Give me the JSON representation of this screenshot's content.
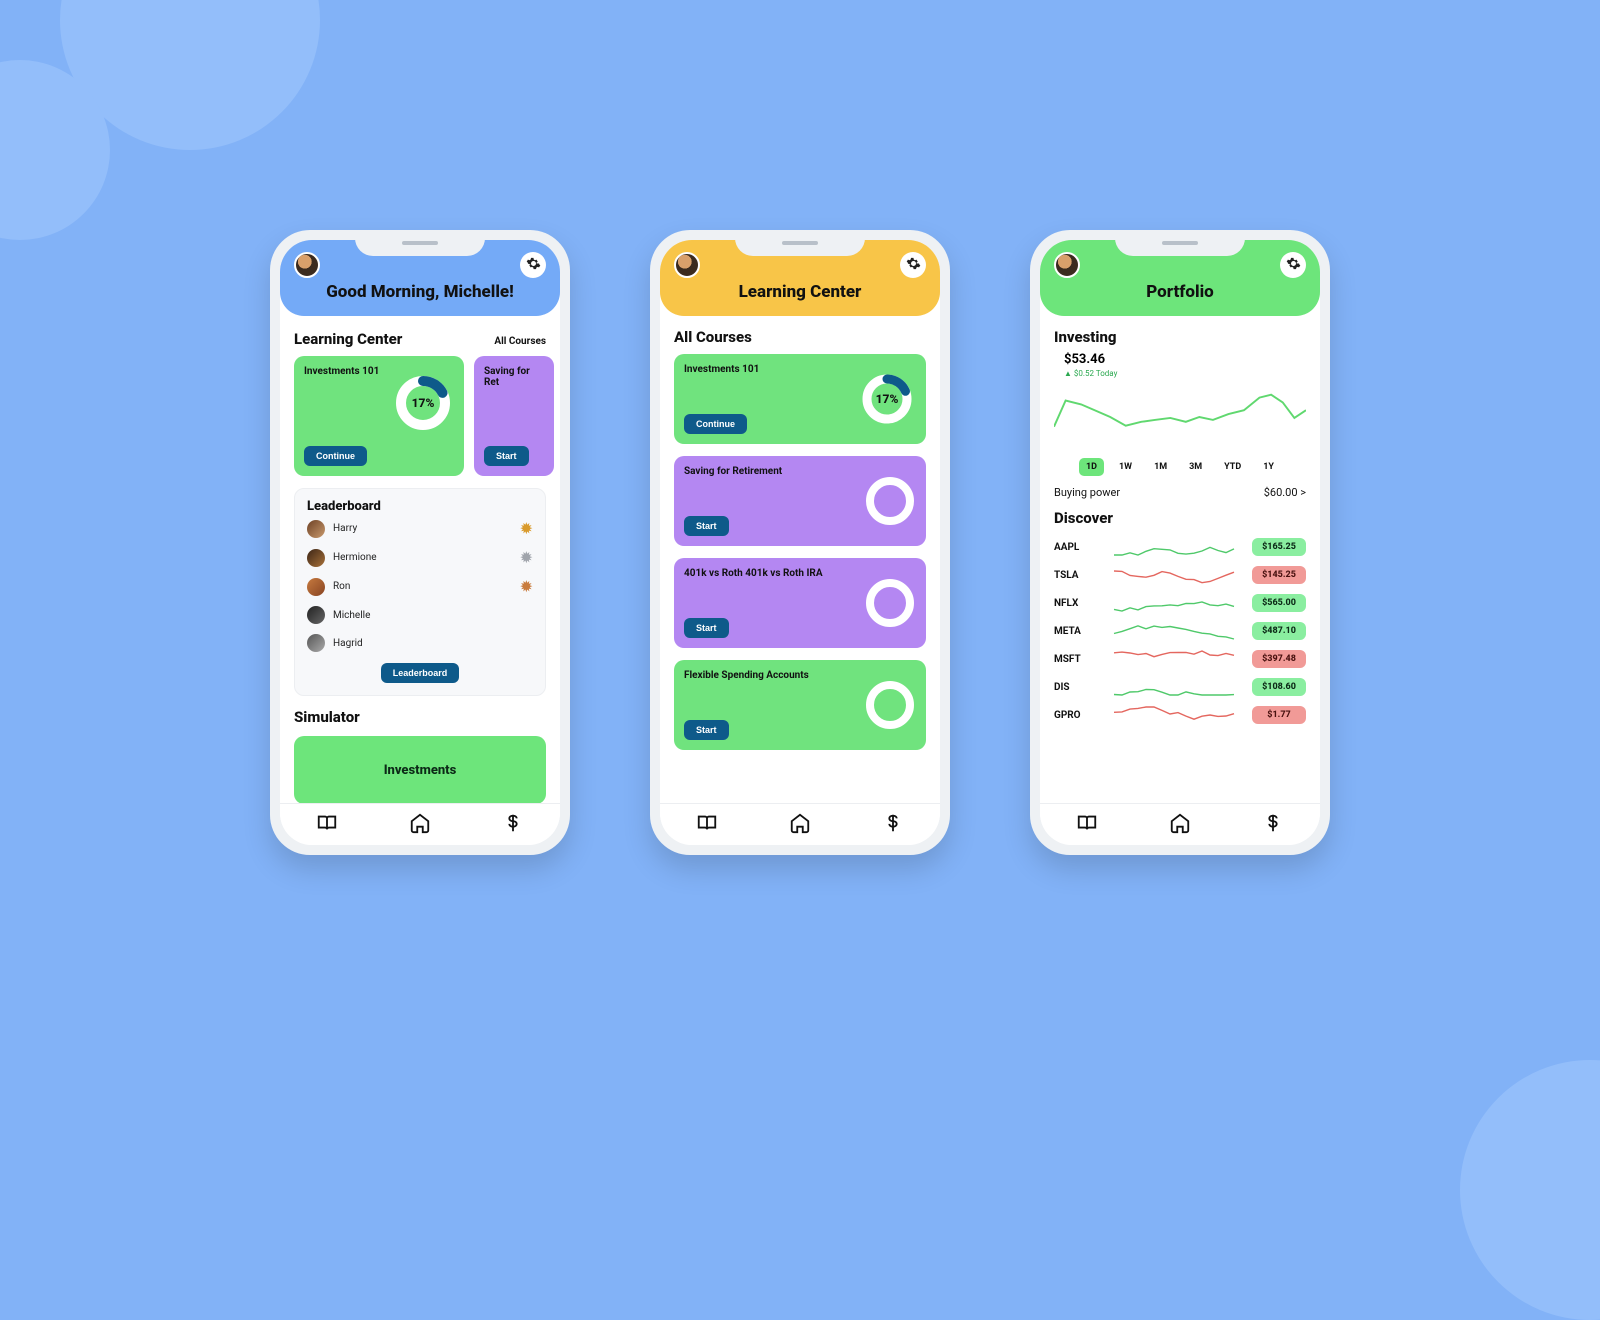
{
  "colors": {
    "blue": "#74aaf7",
    "yellow": "#f8c548",
    "green": "#6de57b",
    "purple": "#b487f2",
    "darkblue": "#0e5a8a"
  },
  "home": {
    "greeting": "Good Morning, Michelle!",
    "learning_title": "Learning Center",
    "all_courses_link": "All Courses",
    "cards": [
      {
        "title": "Investments 101",
        "button": "Continue",
        "progress_pct": "17%",
        "progress_val": 17
      },
      {
        "title": "Saving for Ret",
        "button": "Start"
      }
    ],
    "leaderboard_title": "Leaderboard",
    "leaderboard_button": "Leaderboard",
    "leaderboard": [
      {
        "name": "Harry",
        "medal": "gold"
      },
      {
        "name": "Hermione",
        "medal": "silver"
      },
      {
        "name": "Ron",
        "medal": "bronze"
      },
      {
        "name": "Michelle",
        "medal": ""
      },
      {
        "name": "Hagrid",
        "medal": ""
      }
    ],
    "simulator_title": "Simulator",
    "simulator_button": "Investments"
  },
  "learning": {
    "header": "Learning Center",
    "list_title": "All Courses",
    "courses": [
      {
        "title": "Investments 101",
        "button": "Continue",
        "progress_pct": "17%",
        "progress_val": 17,
        "color": "green"
      },
      {
        "title": "Saving for Retirement",
        "button": "Start",
        "color": "purple"
      },
      {
        "title": "401k vs Roth 401k vs Roth IRA",
        "button": "Start",
        "color": "purple"
      },
      {
        "title": "Flexible Spending Accounts",
        "button": "Start",
        "color": "green"
      }
    ]
  },
  "portfolio": {
    "header": "Portfolio",
    "investing_title": "Investing",
    "amount": "$53.46",
    "delta": "▲ $0.52 Today",
    "ranges": [
      "1D",
      "1W",
      "1M",
      "3M",
      "YTD",
      "1Y"
    ],
    "active_range": "1D",
    "buying_power_label": "Buying power",
    "buying_power_value": "$60.00 >",
    "discover_title": "Discover",
    "stocks": [
      {
        "ticker": "AAPL",
        "price": "$165.25",
        "trend": "up"
      },
      {
        "ticker": "TSLA",
        "price": "$145.25",
        "trend": "down"
      },
      {
        "ticker": "NFLX",
        "price": "$565.00",
        "trend": "up"
      },
      {
        "ticker": "META",
        "price": "$487.10",
        "trend": "up"
      },
      {
        "ticker": "MSFT",
        "price": "$397.48",
        "trend": "down"
      },
      {
        "ticker": "DIS",
        "price": "$108.60",
        "trend": "up"
      },
      {
        "ticker": "GPRO",
        "price": "$1.77",
        "trend": "down"
      }
    ]
  },
  "chart_data": {
    "type": "line",
    "title": "Investing",
    "ylabel": "$",
    "series": [
      {
        "name": "Portfolio",
        "values": [
          52.9,
          53.6,
          53.5,
          53.3,
          53.1,
          52.8,
          52.9,
          53.0,
          53.1,
          53.0,
          53.2,
          53.1,
          53.3,
          53.5,
          53.9,
          53.8,
          53.3,
          53.46
        ]
      }
    ],
    "xlabel": "",
    "ylim": [
      52.5,
      54.0
    ]
  }
}
